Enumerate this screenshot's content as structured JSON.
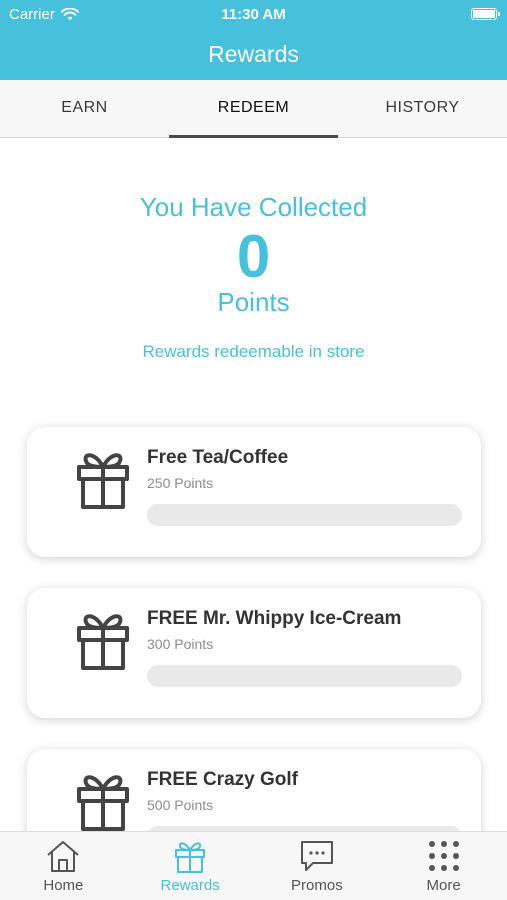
{
  "status_bar": {
    "carrier": "Carrier",
    "time": "11:30 AM",
    "icons": [
      "wifi-icon",
      "battery-icon"
    ]
  },
  "nav": {
    "title": "Rewards"
  },
  "tabs": [
    {
      "label": "EARN",
      "active": false
    },
    {
      "label": "REDEEM",
      "active": true
    },
    {
      "label": "HISTORY",
      "active": false
    }
  ],
  "summary": {
    "heading": "You Have Collected",
    "points": "0",
    "points_label": "Points",
    "note": "Rewards redeemable in store"
  },
  "rewards": [
    {
      "name": "Free Tea/Coffee",
      "points": "250 Points",
      "progress": 0,
      "icon": "gift-icon"
    },
    {
      "name": "FREE Mr. Whippy Ice-Cream",
      "points": "300 Points",
      "progress": 0,
      "icon": "gift-icon"
    },
    {
      "name": "FREE Crazy Golf",
      "points": "500 Points",
      "progress": 0,
      "icon": "gift-icon"
    }
  ],
  "bottom_tabs": [
    {
      "label": "Home",
      "icon": "home-icon",
      "active": false
    },
    {
      "label": "Rewards",
      "icon": "gift-icon",
      "active": true
    },
    {
      "label": "Promos",
      "icon": "chat-bubble-icon",
      "active": false
    },
    {
      "label": "More",
      "icon": "grid-dots-icon",
      "active": false
    }
  ],
  "colors": {
    "accent": "#47c0dc",
    "text_dark": "#333333",
    "text_muted": "#8c8c8c",
    "progress_track": "#e9e9e9"
  }
}
